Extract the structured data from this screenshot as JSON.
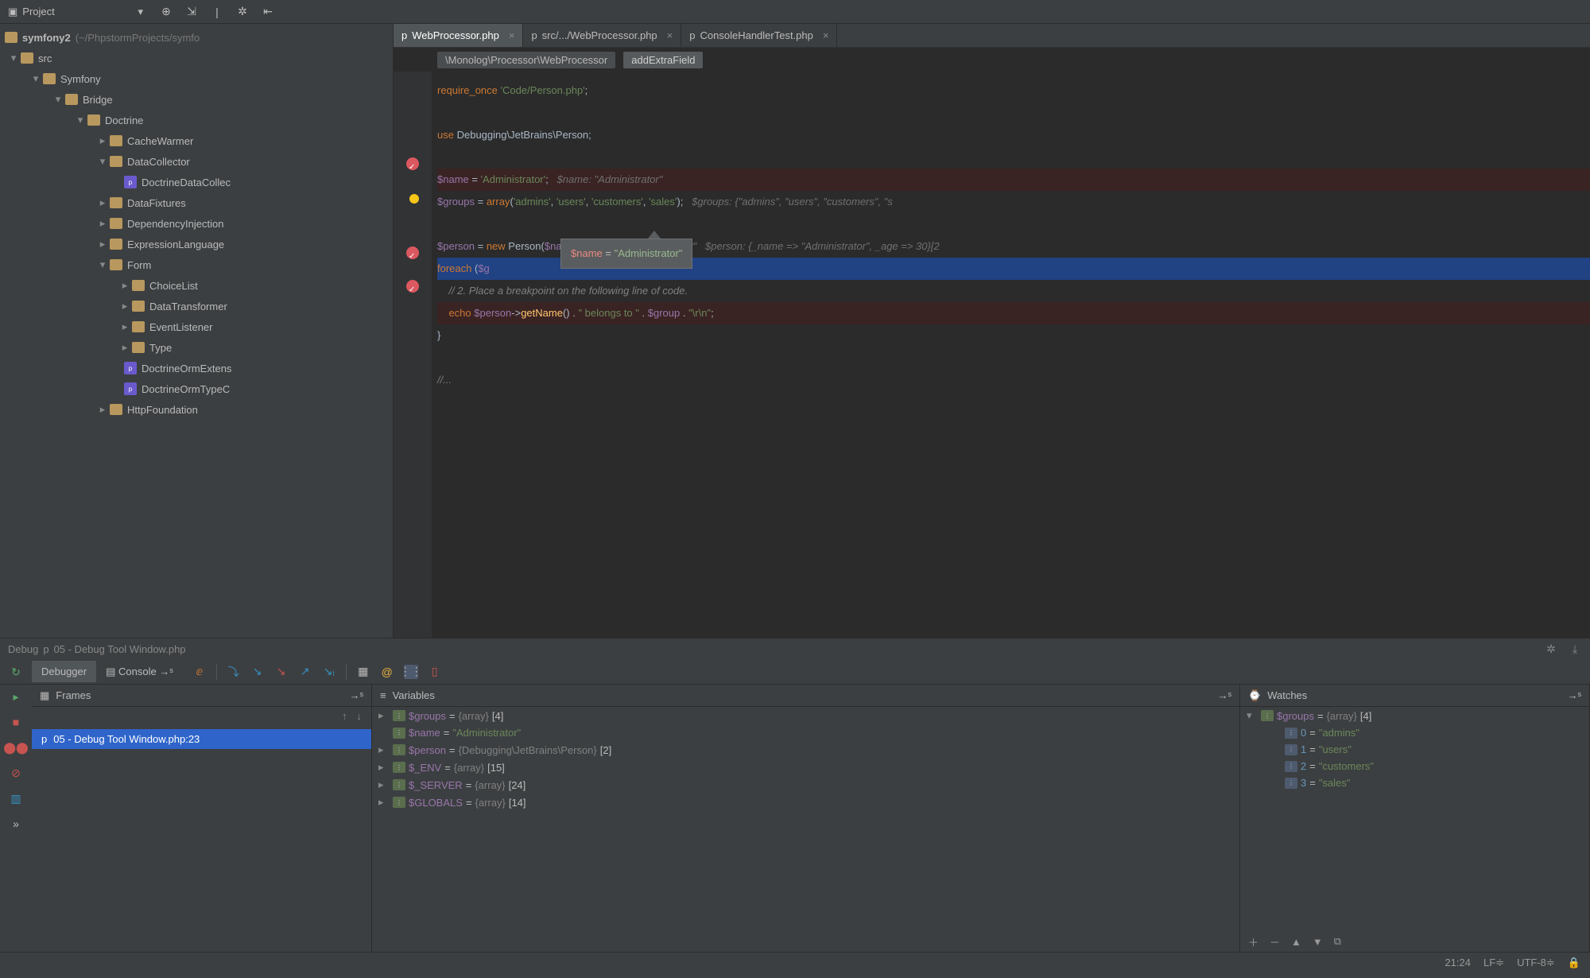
{
  "toolbar": {
    "project_label": "Project"
  },
  "project": {
    "root": "symfony2",
    "root_path": "(~/PhpstormProjects/symfo",
    "tree": {
      "src": "src",
      "symfony": "Symfony",
      "bridge": "Bridge",
      "doctrine": "Doctrine",
      "cachewarmer": "CacheWarmer",
      "datacollector": "DataCollector",
      "doctrinedatacollec": "DoctrineDataCollec",
      "datafixtures": "DataFixtures",
      "di": "DependencyInjection",
      "el": "ExpressionLanguage",
      "form": "Form",
      "choicelist": "ChoiceList",
      "datatransformer": "DataTransformer",
      "eventlistener": "EventListener",
      "type": "Type",
      "doctrineormextens": "DoctrineOrmExtens",
      "doctrineormtypec": "DoctrineOrmTypeC",
      "httpfoundation": "HttpFoundation"
    }
  },
  "tabs": [
    {
      "label": "WebProcessor.php",
      "active": true
    },
    {
      "label": "src/.../WebProcessor.php",
      "active": false
    },
    {
      "label": "ConsoleHandlerTest.php",
      "active": false
    }
  ],
  "breadcrumb": {
    "ns": "\\Monolog\\Processor\\WebProcessor",
    "fn": "addExtraField"
  },
  "code": {
    "l1a": "require_once",
    "l1b": "'Code/Person.php'",
    "l2a": "use",
    "l2b": "Debugging\\JetBrains\\Person;",
    "l3a": "$name",
    "l3b": "'Administrator'",
    "l3c": "$name: \"Administrator\"",
    "l4a": "$groups",
    "l4b": "array",
    "l4c": "'admins'",
    "l4d": "'users'",
    "l4e": "'customers'",
    "l4f": "'sales'",
    "l4g": "$groups: {\"admins\", \"users\", \"customers\", \"s",
    "l5a": "$person",
    "l5b": "new",
    "l5c": "Person",
    "l5d": "$name",
    "l5e": "$name: \"Administrator\"",
    "l5f": "$person: {_name => \"Administrator\", _age => 30}[2",
    "l6a": "foreach",
    "l6b": "$g",
    "l7": "// 2. Place a breakpoint on the following line of code.",
    "l8a": "echo",
    "l8b": "$person",
    "l8c": "getName",
    "l8d": "\" belongs to \"",
    "l8e": "$group",
    "l8f": "\"\\r\\n\"",
    "l9": "}",
    "l10": "//..."
  },
  "tooltip": {
    "var": "$name",
    "eq": " = ",
    "val": "\"Administrator\""
  },
  "debug": {
    "header": "Debug",
    "header_file": "05 - Debug Tool Window.php",
    "tabs": {
      "debugger": "Debugger",
      "console": "Console"
    },
    "frames": {
      "title": "Frames",
      "item": "05 - Debug Tool Window.php:23"
    },
    "variables": {
      "title": "Variables",
      "rows": [
        {
          "name": "$groups",
          "type": "{array}",
          "extra": "[4]"
        },
        {
          "name": "$name",
          "val": "\"Administrator\""
        },
        {
          "name": "$person",
          "type": "{Debugging\\JetBrains\\Person}",
          "extra": "[2]"
        },
        {
          "name": "$_ENV",
          "type": "{array}",
          "extra": "[15]"
        },
        {
          "name": "$_SERVER",
          "type": "{array}",
          "extra": "[24]"
        },
        {
          "name": "$GLOBALS",
          "type": "{array}",
          "extra": "[14]"
        }
      ]
    },
    "watches": {
      "title": "Watches",
      "root": {
        "name": "$groups",
        "type": "{array}",
        "extra": "[4]"
      },
      "children": [
        {
          "idx": "0",
          "val": "\"admins\""
        },
        {
          "idx": "1",
          "val": "\"users\""
        },
        {
          "idx": "2",
          "val": "\"customers\""
        },
        {
          "idx": "3",
          "val": "\"sales\""
        }
      ]
    }
  },
  "status": {
    "pos": "21:24",
    "le": "LF≑",
    "enc": "UTF-8≑"
  }
}
